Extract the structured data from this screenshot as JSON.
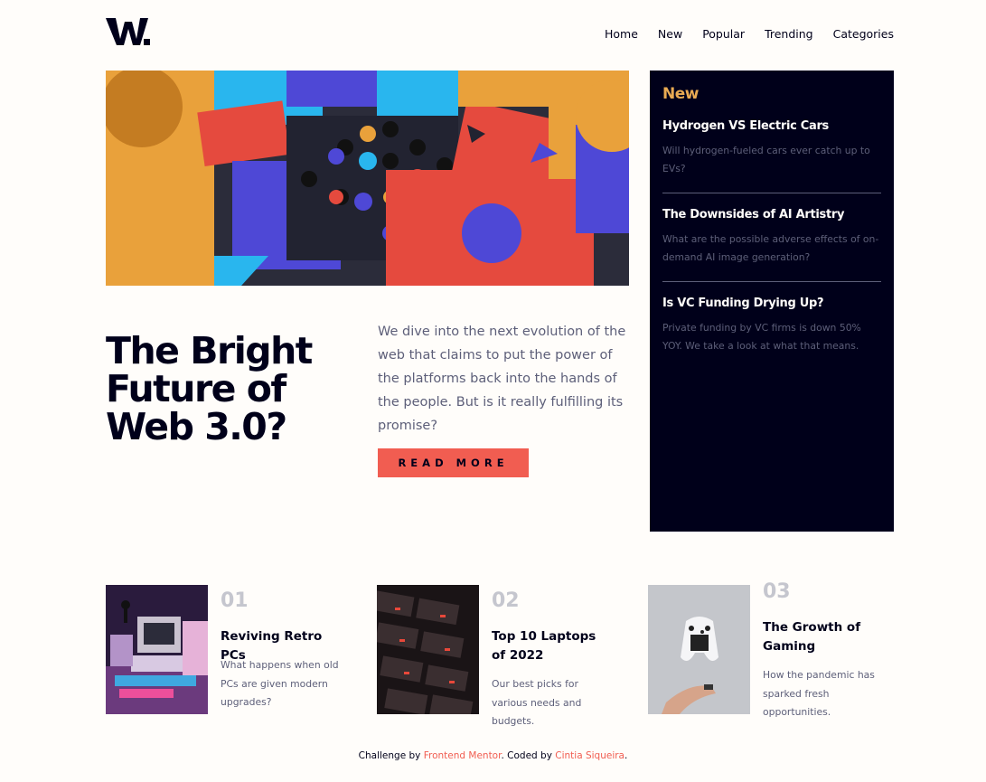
{
  "header": {
    "logo_icon": "w-logo-icon",
    "nav": [
      "Home",
      "New",
      "Popular",
      "Trending",
      "Categories"
    ]
  },
  "hero": {
    "image_icon": "abstract-3d-blocks-image",
    "title": "The Bright Future of Web 3.0?",
    "description": "We dive into the next evolution of the web that claims to put the power of the platforms back into the hands of the people. But is it really fulfilling its promise?",
    "button": "READ MORE"
  },
  "new_panel": {
    "heading": "New",
    "items": [
      {
        "title": "Hydrogen VS Electric Cars",
        "desc": "Will hydrogen-fueled cars ever catch up to EVs?"
      },
      {
        "title": "The Downsides of AI Artistry",
        "desc": "What are the possible adverse effects of on-demand AI image generation?"
      },
      {
        "title": "Is VC Funding Drying Up?",
        "desc": "Private funding by VC firms is down 50% YOY. We take a look at what that means."
      }
    ]
  },
  "cards": [
    {
      "num": "01",
      "title": "Reviving Retro PCs",
      "desc": "What happens when old PCs are given modern upgrades?"
    },
    {
      "num": "02",
      "title": "Top 10 Laptops of 2022",
      "desc": "Our best picks for various needs and budgets."
    },
    {
      "num": "03",
      "title": "The Growth of Gaming",
      "desc": "How the pandemic has sparked fresh opportunities."
    }
  ],
  "footer": {
    "prefix": "Challenge by ",
    "link1": "Frontend Mentor",
    "middle": ". Coded by ",
    "link2": "Cintia Siqueira",
    "suffix": "."
  },
  "colors": {
    "background": "#fffdfa",
    "dark": "#00001a",
    "accent_red": "#f15d51",
    "accent_orange": "#e9ab53",
    "grayish_blue": "#5d5f79"
  }
}
